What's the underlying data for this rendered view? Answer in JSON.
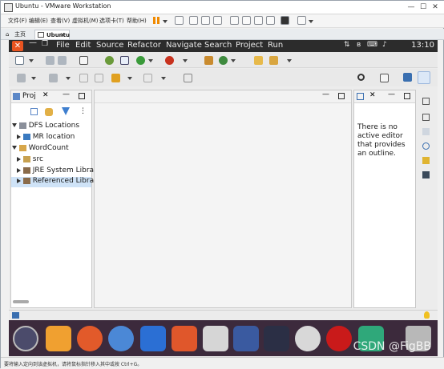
{
  "vmware": {
    "title": "Ubuntu - VMware Workstation",
    "menu": [
      "文件(F)",
      "编辑(E)",
      "查看(V)",
      "虚拟机(M)",
      "选项卡(T)",
      "帮助(H)"
    ],
    "tabs": [
      "主页",
      "Ubuntu"
    ],
    "status_text": "要将输入定向到该虚拟机，请将鼠标指针移入其中或按 Ctrl+G。"
  },
  "ubuntu": {
    "menu": [
      "File",
      "Edit",
      "Source",
      "Refactor",
      "Navigate",
      "Search",
      "Project",
      "Run"
    ],
    "clock": "13:10",
    "close_glyph": "✕"
  },
  "eclipse": {
    "project_tab": "Proj",
    "tree": {
      "dfs": "DFS Locations",
      "mr": "MR location",
      "wordcount": "WordCount",
      "src": "src",
      "jre": "JRE System Libra",
      "ref": "Referenced Libra"
    },
    "outline_msg": [
      "There is no",
      "active editor",
      "that provides",
      "an outline."
    ]
  },
  "watermark": "CSDN @FigBB",
  "colors": {
    "ubuntu_orange": "#e95420",
    "selection": "#cfe3f7",
    "dock_bg": "#3c2a3c"
  }
}
